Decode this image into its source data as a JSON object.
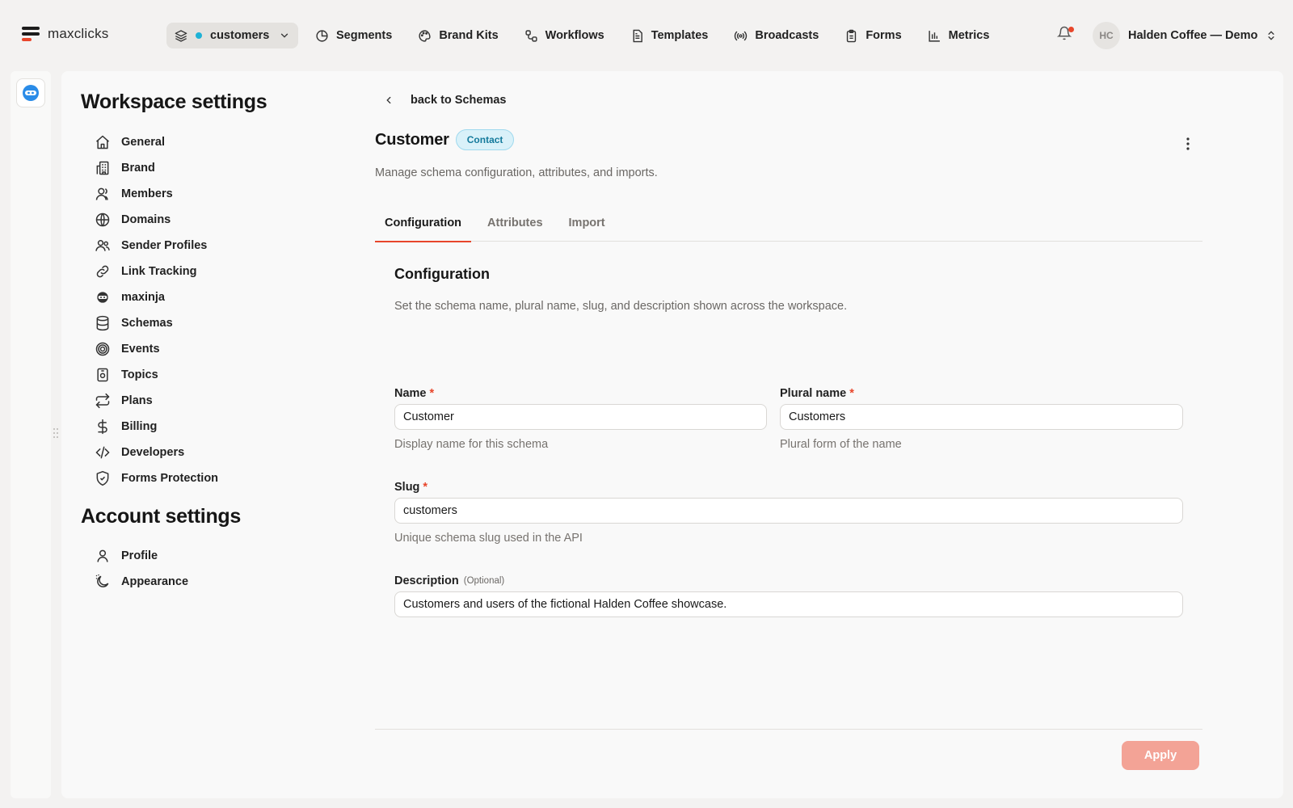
{
  "colors": {
    "accent": "#e8462b",
    "status_dot": "#1fb2d6",
    "badge_bg": "#d9f1f9",
    "badge_border": "#9fd9ee",
    "badge_text": "#147a9c",
    "apply_bg": "#f3a396",
    "notification_dot": "#e8462b",
    "bot_icon": "#2a8ce8"
  },
  "brand": {
    "name": "maxclicks"
  },
  "project_switcher": {
    "label": "customers"
  },
  "nav": [
    {
      "label": "Segments",
      "icon": "pie-chart-icon"
    },
    {
      "label": "Brand Kits",
      "icon": "palette-icon"
    },
    {
      "label": "Workflows",
      "icon": "workflow-icon"
    },
    {
      "label": "Templates",
      "icon": "document-icon"
    },
    {
      "label": "Broadcasts",
      "icon": "broadcast-icon"
    },
    {
      "label": "Forms",
      "icon": "clipboard-icon"
    },
    {
      "label": "Metrics",
      "icon": "bar-chart-icon"
    }
  ],
  "account": {
    "initials": "HC",
    "name": "Halden Coffee — Demo"
  },
  "sidebar": {
    "workspace_title": "Workspace settings",
    "workspace_items": [
      {
        "label": "General",
        "icon": "home-icon"
      },
      {
        "label": "Brand",
        "icon": "building-icon"
      },
      {
        "label": "Members",
        "icon": "user-icon"
      },
      {
        "label": "Domains",
        "icon": "globe-icon"
      },
      {
        "label": "Sender Profiles",
        "icon": "users-icon"
      },
      {
        "label": "Link Tracking",
        "icon": "link-icon"
      },
      {
        "label": "maxinja",
        "icon": "ninja-icon"
      },
      {
        "label": "Schemas",
        "icon": "database-icon"
      },
      {
        "label": "Events",
        "icon": "target-icon"
      },
      {
        "label": "Topics",
        "icon": "topic-icon"
      },
      {
        "label": "Plans",
        "icon": "repeat-icon"
      },
      {
        "label": "Billing",
        "icon": "dollar-icon"
      },
      {
        "label": "Developers",
        "icon": "code-icon"
      },
      {
        "label": "Forms Protection",
        "icon": "shield-check-icon"
      }
    ],
    "account_title": "Account settings",
    "account_items": [
      {
        "label": "Profile",
        "icon": "user-icon"
      },
      {
        "label": "Appearance",
        "icon": "moon-icon"
      }
    ]
  },
  "main": {
    "back_label": "back to Schemas",
    "title": "Customer",
    "badge": "Contact",
    "subtitle": "Manage schema configuration, attributes, and imports.",
    "tabs": [
      "Configuration",
      "Attributes",
      "Import"
    ],
    "active_tab": 0,
    "section": {
      "title": "Configuration",
      "subtitle": "Set the schema name, plural name, slug, and description shown across the workspace."
    },
    "fields": {
      "name": {
        "label": "Name",
        "required": "*",
        "value": "Customer",
        "help": "Display name for this schema"
      },
      "plural": {
        "label": "Plural name",
        "required": "*",
        "value": "Customers",
        "help": "Plural form of the name"
      },
      "slug": {
        "label": "Slug",
        "required": "*",
        "value": "customers",
        "help": "Unique schema slug used in the API"
      },
      "description": {
        "label": "Description",
        "optional": "(Optional)",
        "value": "Customers and users of the fictional Halden Coffee showcase."
      }
    },
    "apply_label": "Apply"
  }
}
